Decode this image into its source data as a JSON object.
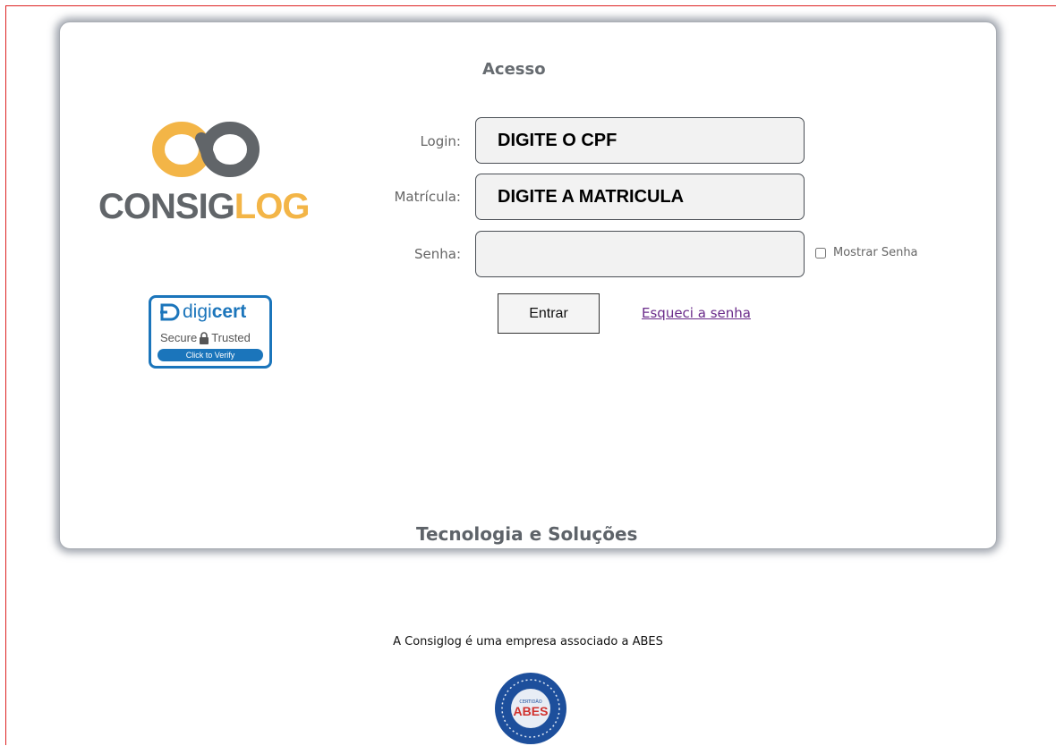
{
  "page": {
    "title": "Acesso",
    "footer_title": "Tecnologia e Soluções"
  },
  "logo": {
    "text_part1": "CONSIG",
    "text_part2": "LOG",
    "colors": {
      "gray": "#616569",
      "gold": "#f3b547"
    }
  },
  "badge": {
    "brand_prefix": "digi",
    "brand_suffix": "cert",
    "secure_text": "Secure",
    "trusted_text": "Trusted",
    "verify_text": "Click to Verify",
    "icons": [
      "digicert-icon",
      "lock-icon"
    ]
  },
  "form": {
    "login_label": "Login:",
    "login_value": "DIGITE O CPF",
    "matricula_label": "Matrícula:",
    "matricula_value": "DIGITE A MATRICULA",
    "senha_label": "Senha:",
    "senha_value": "",
    "show_password_label": "Mostrar Senha",
    "show_password_checked": false,
    "submit_label": "Entrar",
    "forgot_label": "Esqueci a senha"
  },
  "footer": {
    "association_text_prefix": "A ",
    "association_company": "Consiglog",
    "association_text_suffix": " é uma empresa associado a ABES",
    "seal_icon": "abes-seal-icon",
    "seal_text": "ABES",
    "seal_small": "CERTIDÃO"
  },
  "colors": {
    "frame_border": "#dd2222",
    "link": "#6a2b8a",
    "digicert_blue": "#1b75bb",
    "abes_blue": "#1d4f9c"
  }
}
